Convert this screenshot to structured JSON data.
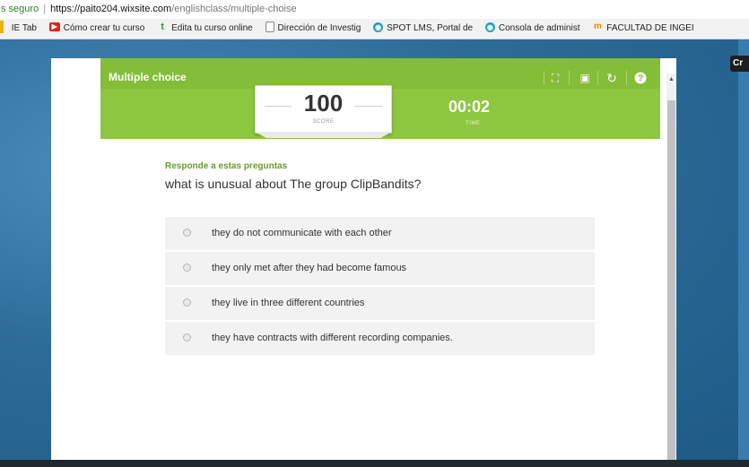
{
  "browser": {
    "security": "s seguro",
    "url_host": "https://paito204.wixsite.com",
    "url_path": "/englishclass/multiple-choise",
    "bookmarks": [
      {
        "label": "IE Tab",
        "icon": "ie-tab-icon"
      },
      {
        "label": "Cómo crear tu curso",
        "icon": "youtube-icon"
      },
      {
        "label": "Edita tu curso online",
        "icon": "tumblr-icon"
      },
      {
        "label": "Dirección de Investig",
        "icon": "page-icon"
      },
      {
        "label": "SPOT LMS, Portal de",
        "icon": "spot-icon"
      },
      {
        "label": "Consola de administ",
        "icon": "spot-icon"
      },
      {
        "label": "FACULTAD DE INGEI",
        "icon": "moodle-icon"
      }
    ],
    "side_tab": "Cr"
  },
  "quiz": {
    "title": "Multiple choice",
    "score": "100",
    "score_label": "SCORE",
    "time": "00:02",
    "time_label": "TIME",
    "instruction": "Responde a estas preguntas",
    "question": "what is unusual about The group ClipBandits?",
    "options": [
      "they do not communicate with each other",
      "they only met after they had become famous",
      "they live in three different countries",
      "they have contracts with different recording companies."
    ],
    "header_icons": [
      "fullscreen-icon",
      "print-icon",
      "restart-icon",
      "help-icon"
    ]
  },
  "colors": {
    "accent_green": "#8dc63f",
    "instruction_green": "#6b9a2f"
  }
}
